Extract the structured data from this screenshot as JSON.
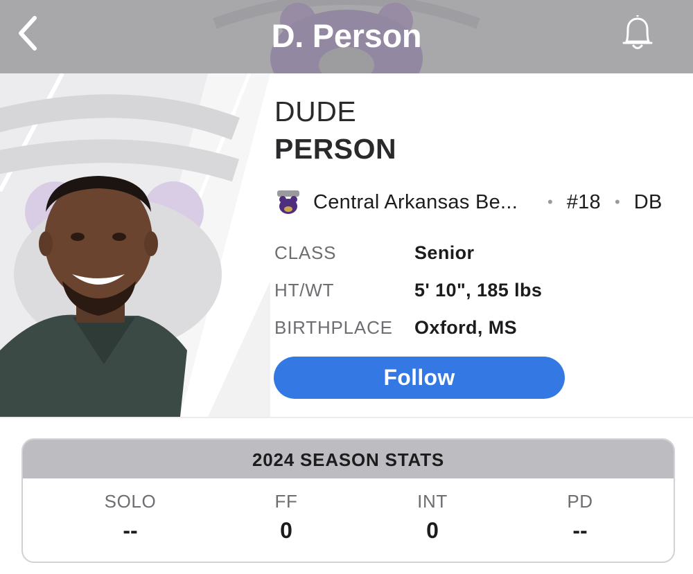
{
  "header": {
    "title": "D. Person",
    "back_icon": "chevron-left-icon",
    "bell_icon": "bell-icon"
  },
  "player": {
    "first_name": "DUDE",
    "last_name": "PERSON",
    "team": "Central Arkansas Be...",
    "separator": "•",
    "jersey": "#18",
    "position": "DB",
    "info": [
      {
        "label": "CLASS",
        "value": "Senior"
      },
      {
        "label": "HT/WT",
        "value": "5' 10\", 185 lbs"
      },
      {
        "label": "BIRTHPLACE",
        "value": "Oxford, MS"
      }
    ]
  },
  "actions": {
    "follow_label": "Follow"
  },
  "stats": {
    "title": "2024 SEASON STATS",
    "items": [
      {
        "label": "SOLO",
        "value": "--"
      },
      {
        "label": "FF",
        "value": "0"
      },
      {
        "label": "INT",
        "value": "0"
      },
      {
        "label": "PD",
        "value": "--"
      }
    ]
  },
  "colors": {
    "header_bg": "#a8a8ab",
    "accent": "#3478e4",
    "team_purple": "#4f2d7f",
    "stats_header_bg": "#bdbdc1"
  }
}
